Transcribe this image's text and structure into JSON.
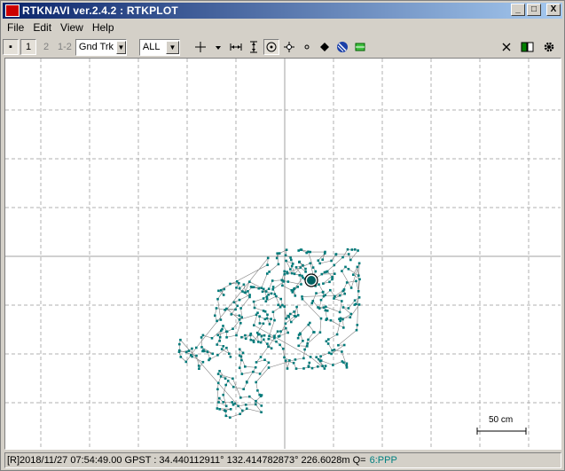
{
  "window": {
    "title": "RTKNAVI ver.2.4.2 : RTKPLOT",
    "min_label": "_",
    "max_label": "□",
    "close_label": "X"
  },
  "menu": {
    "items": [
      "File",
      "Edit",
      "View",
      "Help"
    ]
  },
  "toolbar": {
    "btn_dot": "▪",
    "btn_1": "1",
    "btn_2": "2",
    "btn_12": "1-2",
    "plot_type": "Gnd Trk",
    "sat_filter": "ALL",
    "icons": [
      "crosshair-icon",
      "dropdown-small-icon",
      "fit-horizontal-icon",
      "fit-vertical-icon",
      "center-origin-icon",
      "center-ortho-icon",
      "small-circle-icon",
      "show-point-icon",
      "globe-icon",
      "map-layer-icon"
    ],
    "right_icons": [
      "clear-icon",
      "window-toggle-icon",
      "settings-icon"
    ]
  },
  "plot": {
    "scale_label": "50 cm",
    "marker_color": "#006060",
    "track_color": "#808080",
    "point_color": "#007a7a"
  },
  "status": {
    "text": "[R]2018/11/27 07:54:49.00 GPST :  34.440112911°  132.414782873°  226.6028m  Q=",
    "quality": "6:PPP"
  }
}
